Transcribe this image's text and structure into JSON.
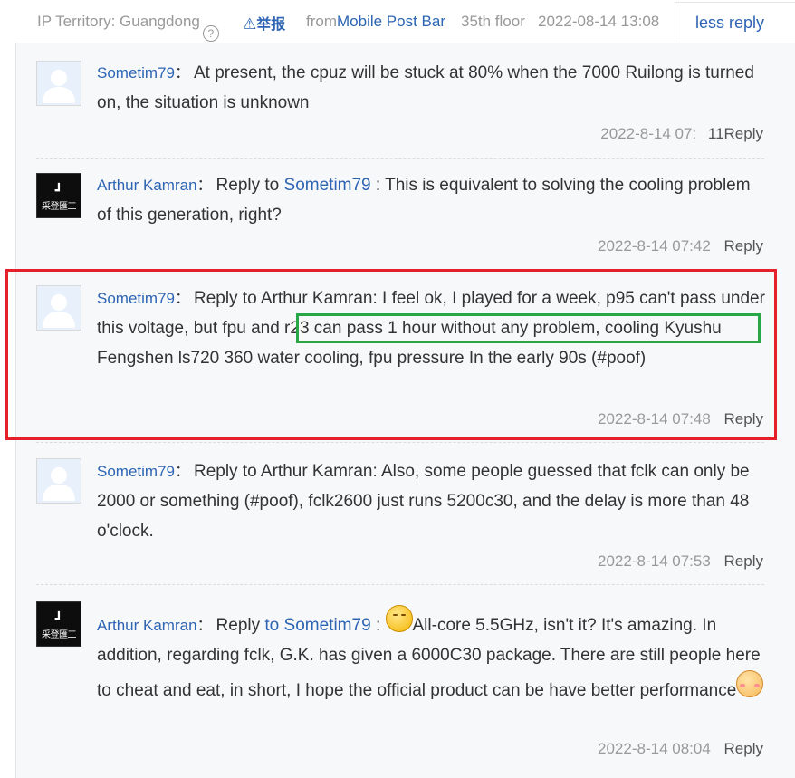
{
  "header": {
    "ip_territory": "IP Territory: Guangdong",
    "help_icon": "question-circle-icon",
    "report_label": "举报",
    "from_label": "from",
    "source": "Mobile Post Bar",
    "floor": "35th floor",
    "datetime": "2022-08-14 13:08",
    "less_reply": "less reply"
  },
  "replies": [
    {
      "user": "Sometim79",
      "avatar": "default-avatar",
      "text": "At present, the cpuz will be stuck at 80% when the 7000 Ruilong is turned on, the situation is unknown",
      "time": "2022-8-14 07:",
      "reply_count": "11",
      "reply_label": "Reply"
    },
    {
      "user": "Arthur Kamran",
      "avatar": "custom-avatar",
      "avatar_text": "采登匯工",
      "reply_to_prefix": "Reply to",
      "reply_to_user": "Sometim79",
      "text": ": This is equivalent to solving the cooling problem of this generation, right?",
      "time": "2022-8-14 07:42",
      "reply_label": "Reply"
    },
    {
      "user": "Sometim79",
      "avatar": "default-avatar",
      "text_before": "Reply to Arthur Kamran: I feel ok, I played for a week, p95 can't pass under this voltage,",
      "highlight": "but fpu and r23 can pass 1 hour without any problem,",
      "text_after": "cooling Kyushu Fengshen ls720 360 water cooling, fpu pressure In the early 90s (#poof)",
      "time": "2022-8-14 07:48",
      "reply_label": "Reply"
    },
    {
      "user": "Sometim79",
      "avatar": "default-avatar",
      "text": "Reply to Arthur Kamran: Also, some people guessed that fclk can only be 2000 or something (#poof), fclk2600 just runs 5200c30, and the delay is more than 48 o'clock.",
      "time": "2022-8-14 07:53",
      "reply_label": "Reply"
    },
    {
      "user": "Arthur Kamran",
      "avatar": "custom-avatar",
      "avatar_text": "采登匯工",
      "reply_prefix": "Reply",
      "reply_to_prefix": "to",
      "reply_to_user": "Sometim79",
      "text": "All-core 5.5GHz, isn't it? It's amazing. In addition, regarding fclk, G.K. has given a 6000C30 package. There are still people here to cheat and eat, in short, I hope the official product can be have better performance",
      "emoji_start": "smile-emoji",
      "emoji_end": "blush-emoji",
      "time": "2022-8-14 08:04",
      "reply_label": "Reply"
    }
  ],
  "colors": {
    "link": "#2d64b3",
    "highlight_red": "#e5202a",
    "highlight_green": "#27a745",
    "muted": "#999999"
  }
}
